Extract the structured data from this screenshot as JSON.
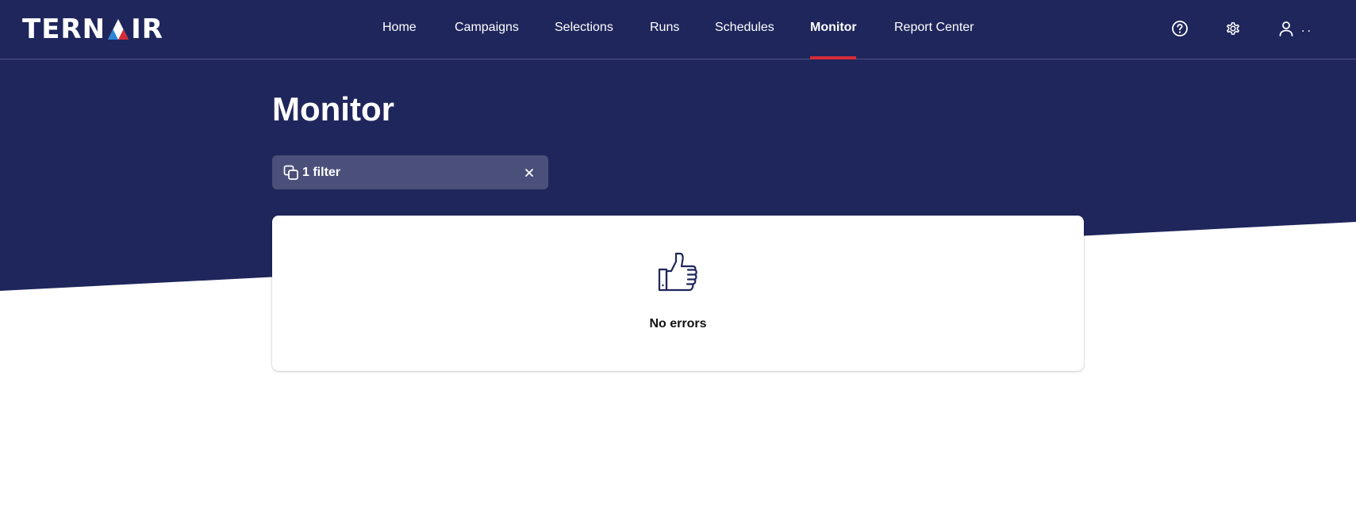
{
  "brand": {
    "logo_text_left": "TERN",
    "logo_text_right": "IR",
    "colors": {
      "navy": "#1f265c",
      "accent_red": "#d62b36",
      "accent_blue": "#2b86d6",
      "chip_bg": "#4a5079"
    }
  },
  "nav": {
    "items": [
      {
        "label": "Home"
      },
      {
        "label": "Campaigns"
      },
      {
        "label": "Selections"
      },
      {
        "label": "Runs"
      },
      {
        "label": "Schedules"
      },
      {
        "label": "Monitor"
      },
      {
        "label": "Report Center"
      }
    ],
    "active": "Monitor"
  },
  "header_actions": {
    "help_icon": "question-circle-icon",
    "settings_icon": "gear-icon",
    "user_icon": "user-icon",
    "user_name": ".."
  },
  "page": {
    "title": "Monitor",
    "filter_chip": {
      "icon": "copy-icon",
      "label": "1 filter",
      "clear_icon": "close-icon"
    }
  },
  "card": {
    "icon": "thumbs-up-icon",
    "message": "No errors"
  }
}
